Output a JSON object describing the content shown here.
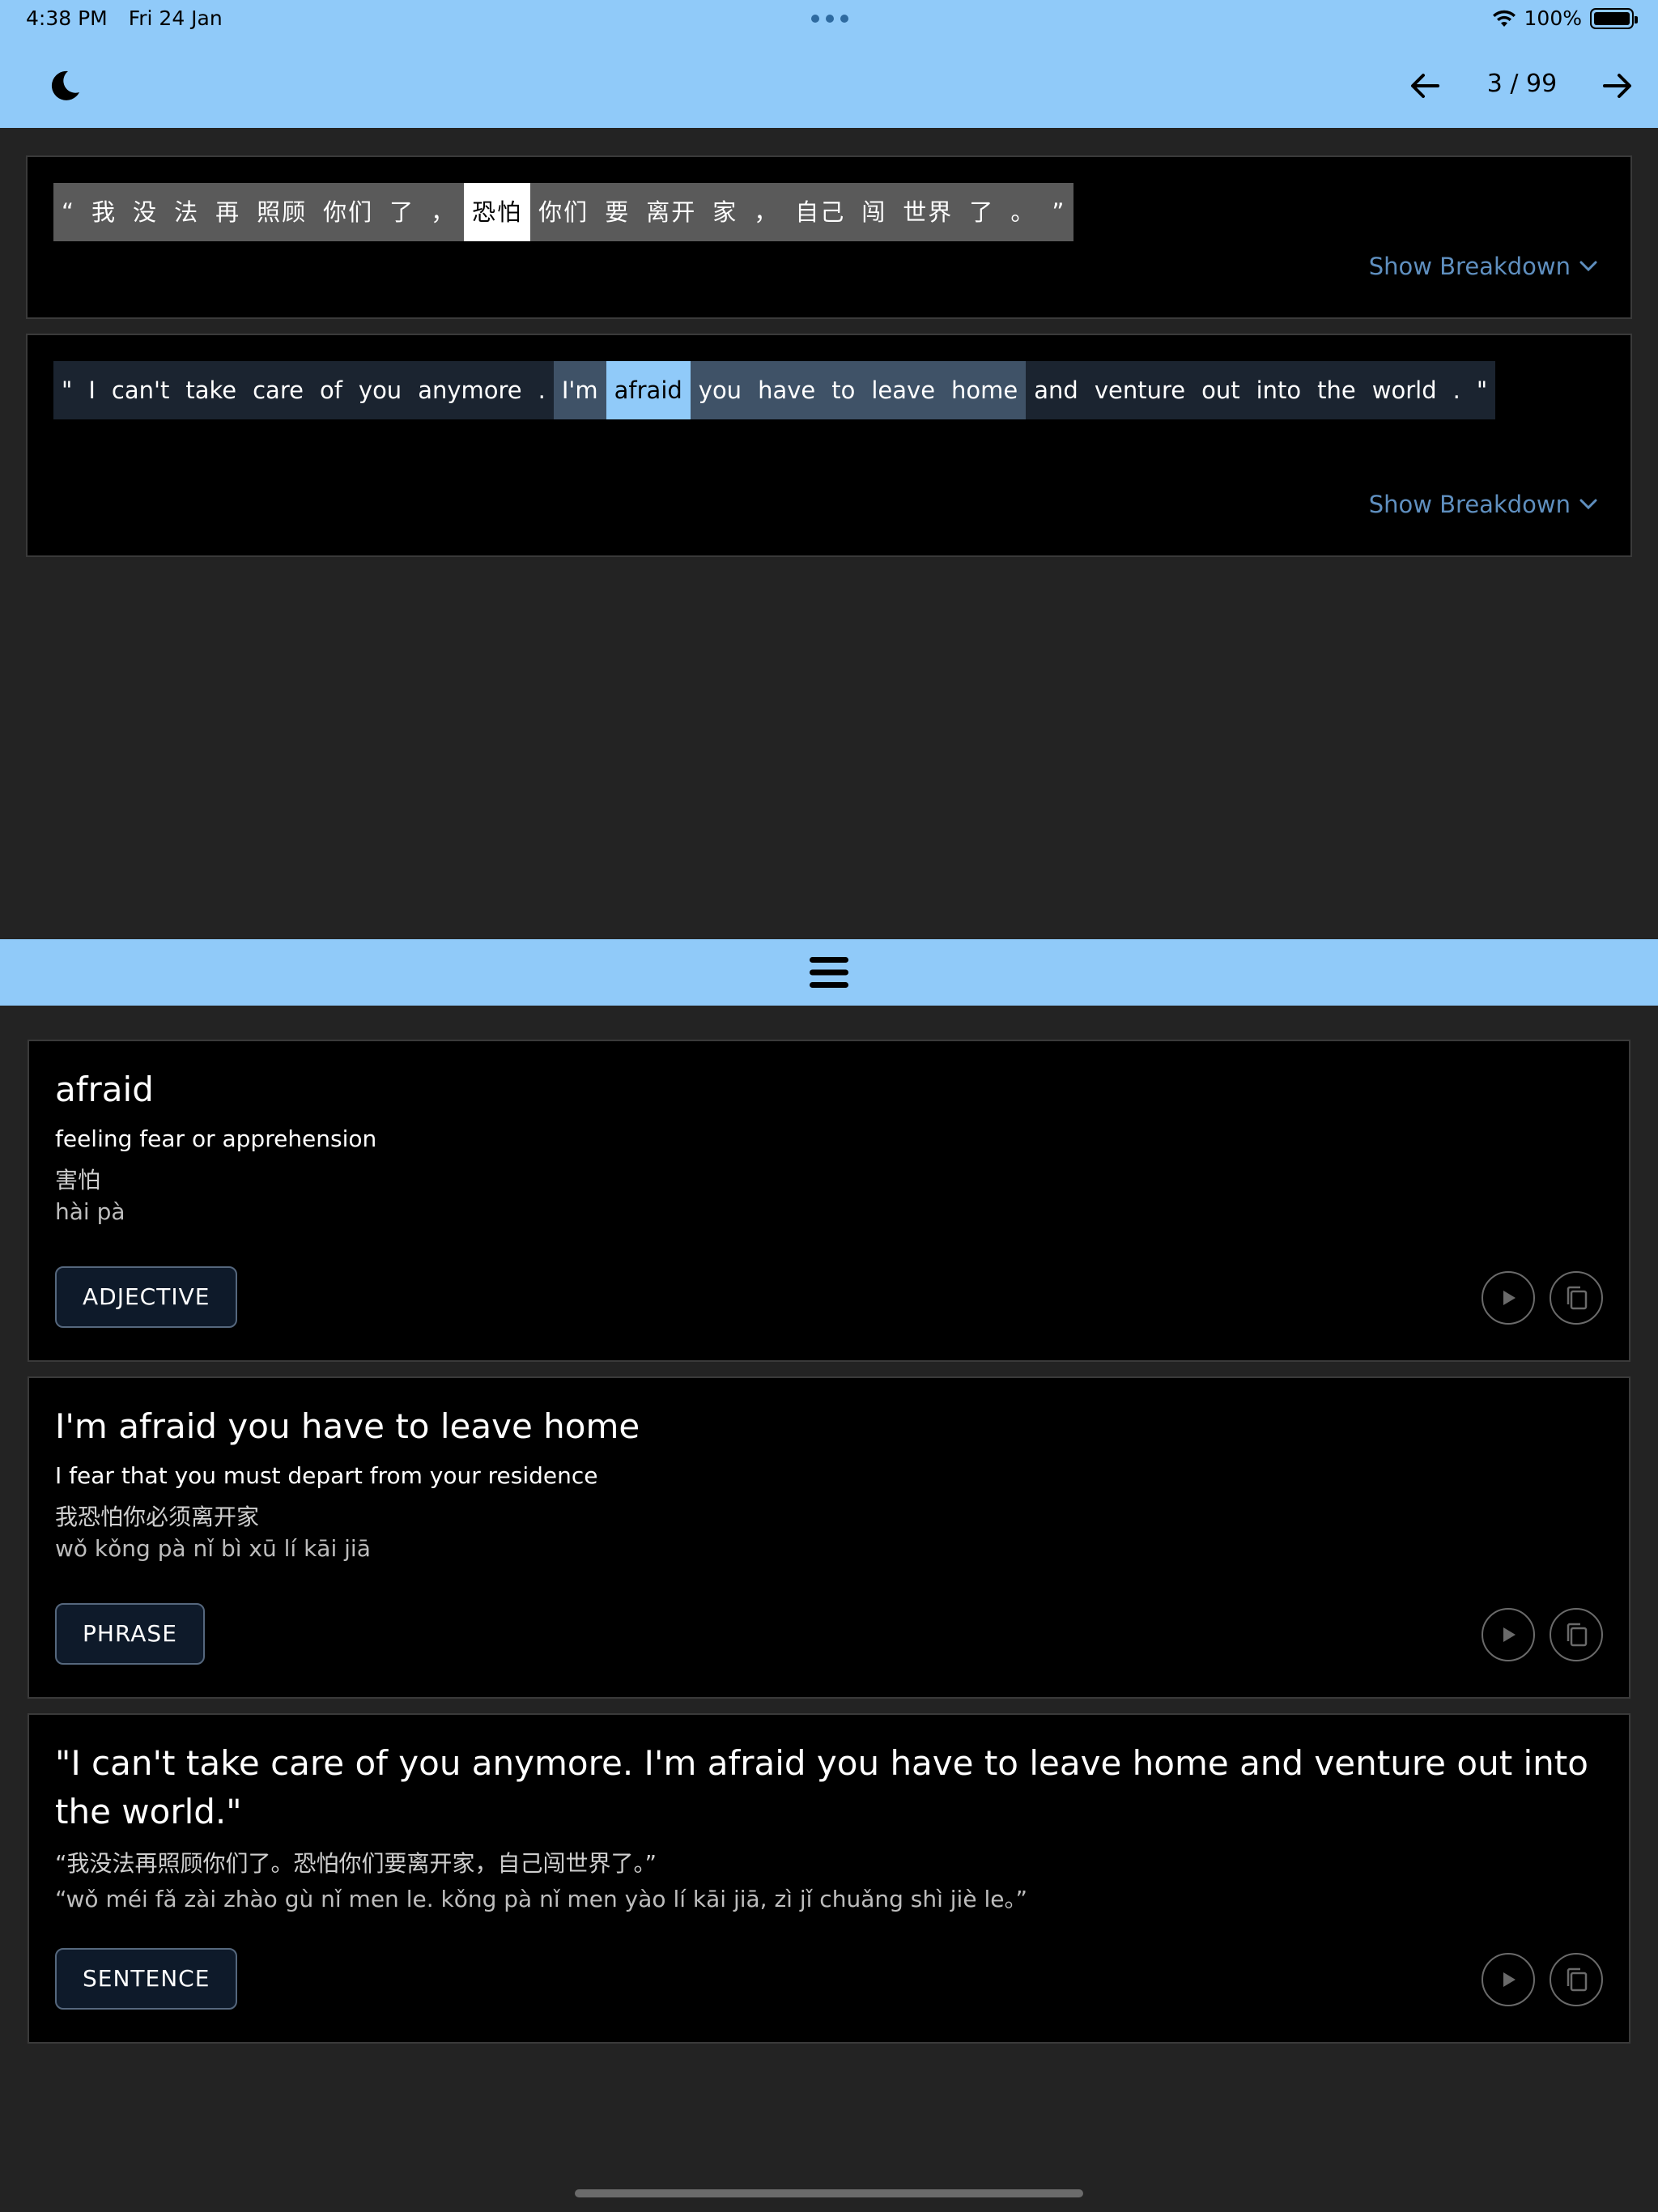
{
  "status": {
    "time": "4:38 PM",
    "date": "Fri 24 Jan",
    "battery": "100%"
  },
  "nav": {
    "page": "3 / 99"
  },
  "chinese_sentence": {
    "tokens": [
      "“",
      "我",
      "没",
      "法",
      "再",
      "照顾",
      "你们",
      "了",
      "，",
      "恐怕",
      "你们",
      "要",
      "离开",
      "家",
      "，",
      "自己",
      "闯",
      "世界",
      "了",
      "。",
      "”"
    ],
    "highlight_index": 9,
    "breakdown_label": "Show Breakdown"
  },
  "english_sentence": {
    "tokens": [
      "\"",
      "I",
      "can't",
      "take",
      "care",
      "of",
      "you",
      "anymore",
      ".",
      "I'm",
      "afraid",
      "you",
      "have",
      "to",
      "leave",
      "home",
      "and",
      "venture",
      "out",
      "into",
      "the",
      "world",
      ".",
      "\""
    ],
    "phrase_range": [
      9,
      15
    ],
    "highlight_index": 10,
    "breakdown_label": "Show Breakdown"
  },
  "cards": [
    {
      "title": "afraid",
      "definition": "feeling fear or apprehension",
      "chinese": "害怕",
      "pinyin": "hài pà",
      "tag": "ADJECTIVE"
    },
    {
      "title": "I'm afraid you have to leave home",
      "definition": "I fear that you must depart from your residence",
      "chinese": "我恐怕你必须离开家",
      "pinyin": "wǒ kǒng pà nǐ bì xū lí kāi jiā",
      "tag": "PHRASE"
    },
    {
      "title": "\"I can't take care of you anymore. I'm afraid you have to leave home and venture out into the world.\"",
      "chinese": "“我没法再照顾你们了。恐怕你们要离开家，自己闯世界了。”",
      "pinyin": "“wǒ méi fǎ zài zhào gù nǐ men le. kǒng pà nǐ men yào lí kāi jiā, zì jǐ chuǎng shì jiè le。”",
      "tag": "SENTENCE"
    }
  ],
  "colors": {
    "accent": "#90caf9",
    "link": "#5f8fbf",
    "phrase_bg": "#3f5267"
  },
  "icons": [
    "moon-icon",
    "arrow-left-icon",
    "arrow-right-icon",
    "menu-icon",
    "play-icon",
    "copy-icon",
    "wifi-icon",
    "battery-icon"
  ]
}
